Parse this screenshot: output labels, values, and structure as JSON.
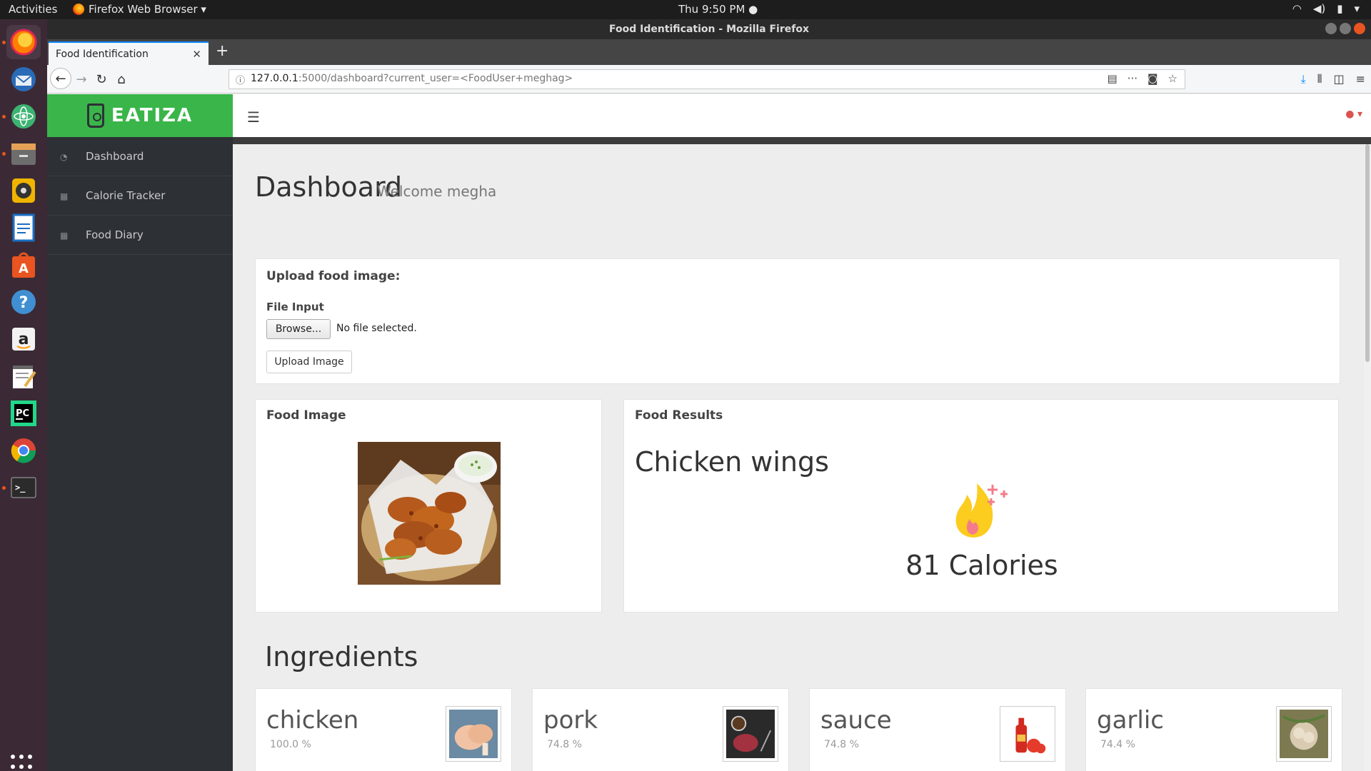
{
  "system_bar": {
    "activities": "Activities",
    "app_name": "Firefox Web Browser ▾",
    "clock": "Thu  9:50 PM ●"
  },
  "window": {
    "title": "Food Identification - Mozilla Firefox"
  },
  "browser": {
    "tab_title": "Food Identification",
    "url_host": "127.0.0.1",
    "url_rest": ":5000/dashboard?current_user=<FoodUser+meghag>"
  },
  "sidebar": {
    "logo_text": "EATIZA",
    "items": [
      {
        "label": "Dashboard",
        "icon": "dashboard-icon"
      },
      {
        "label": "Calorie Tracker",
        "icon": "calendar-icon"
      },
      {
        "label": "Food Diary",
        "icon": "calendar-icon"
      }
    ]
  },
  "page": {
    "title": "Dashboard",
    "welcome": "Welcome megha"
  },
  "upload": {
    "heading": "Upload food image:",
    "file_label": "File Input",
    "browse_label": "Browse...",
    "file_status": "No file selected.",
    "upload_button": "Upload Image"
  },
  "food_image": {
    "heading": "Food Image"
  },
  "results": {
    "heading": "Food Results",
    "food_name": "Chicken wings",
    "calories": "81 Calories"
  },
  "ingredients": {
    "heading": "Ingredients",
    "items": [
      {
        "name": "chicken",
        "confidence": "100.0 %"
      },
      {
        "name": "pork",
        "confidence": "74.8 %"
      },
      {
        "name": "sauce",
        "confidence": "74.8 %"
      },
      {
        "name": "garlic",
        "confidence": "74.4 %"
      }
    ]
  },
  "colors": {
    "brand_green": "#3ab54a",
    "sidebar_bg": "#2d3035",
    "accent_red": "#d9534f"
  }
}
